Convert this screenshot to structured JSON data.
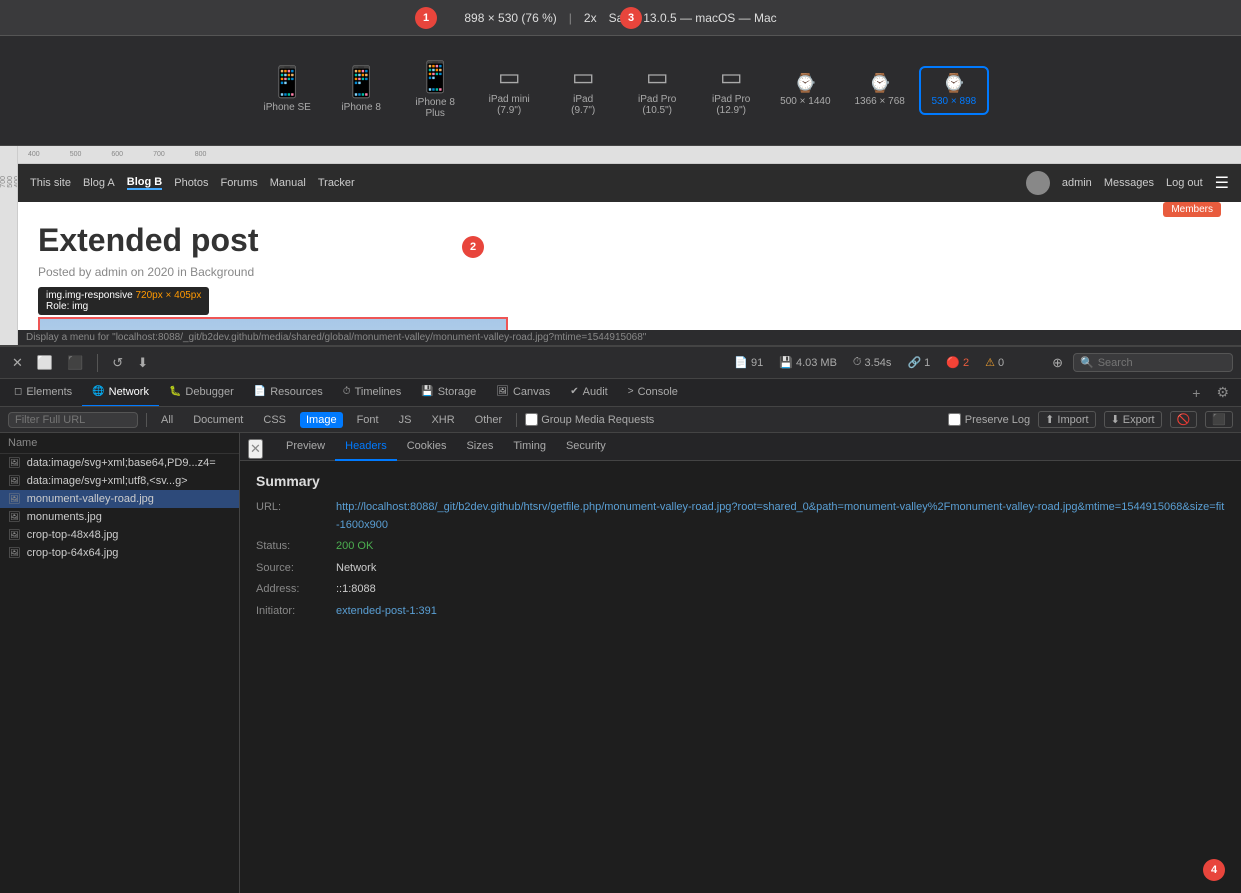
{
  "topbar": {
    "dimensions": "898 × 530  (76 %)",
    "separator": "|",
    "scale": "2x",
    "browser": "Safari 13.0.5 — macOS — Mac",
    "badge1": "1",
    "badge2": "2",
    "badge3": "3",
    "badge4": "4"
  },
  "devices": [
    {
      "id": "iphone-se",
      "label": "iPhone SE",
      "icon": "📱",
      "active": false
    },
    {
      "id": "iphone-8",
      "label": "iPhone 8",
      "icon": "📱",
      "active": false
    },
    {
      "id": "iphone-8-plus",
      "label": "iPhone 8\nPlus",
      "icon": "📱",
      "active": false
    },
    {
      "id": "ipad-mini",
      "label": "iPad mini\n(7.9\")",
      "icon": "📱",
      "active": false
    },
    {
      "id": "ipad-97",
      "label": "iPad\n(9.7\")",
      "icon": "⬜",
      "active": false
    },
    {
      "id": "ipad-pro-105",
      "label": "iPad Pro\n(10.5\")",
      "icon": "⬜",
      "active": false
    },
    {
      "id": "ipad-pro-129",
      "label": "iPad Pro\n(12.9\")",
      "icon": "⬜",
      "active": false
    },
    {
      "id": "500x1440",
      "label": "500 × 1440",
      "icon": "⌚",
      "active": false
    },
    {
      "id": "1366x768",
      "label": "1366 × 768",
      "icon": "⌚",
      "active": false
    },
    {
      "id": "530x898",
      "label": "530 × 898",
      "icon": "⌚",
      "active": true
    }
  ],
  "preview": {
    "nav_items": [
      "This site",
      "Blog A",
      "Blog B",
      "Photos",
      "Forums",
      "Manual",
      "Tracker"
    ],
    "active_nav": "Blog B",
    "admin_links": [
      "admin",
      "Messages",
      "Log out"
    ],
    "post_title": "Extended post",
    "post_meta": "Posted by admin on 2020 in Background",
    "members_badge": "Members",
    "image_tooltip": "img.img-responsive 720px × 405px\nRole: img",
    "status_bar": "Display a menu for \"localhost:8088/_git/b2dev.github/media/shared/global/monument-valley/monument-valley-road.jpg?mtime=1544915068\""
  },
  "devtools_toolbar": {
    "stats": {
      "files": "91",
      "files_icon": "📄",
      "size": "4.03 MB",
      "size_icon": "💾",
      "time": "3.54s",
      "time_icon": "⏱",
      "requests": "1",
      "errors": "2",
      "warnings": "0"
    },
    "search_placeholder": "Search"
  },
  "tabs": [
    {
      "id": "elements",
      "label": "Elements",
      "icon": "◻"
    },
    {
      "id": "network",
      "label": "Network",
      "icon": "🌐",
      "active": true
    },
    {
      "id": "debugger",
      "label": "Debugger",
      "icon": "🐛"
    },
    {
      "id": "resources",
      "label": "Resources",
      "icon": "📄"
    },
    {
      "id": "timelines",
      "label": "Timelines",
      "icon": "⏱"
    },
    {
      "id": "storage",
      "label": "Storage",
      "icon": "💾"
    },
    {
      "id": "canvas",
      "label": "Canvas",
      "icon": "🖼"
    },
    {
      "id": "audit",
      "label": "Audit",
      "icon": "✔"
    },
    {
      "id": "console",
      "label": "Console",
      "icon": ">"
    }
  ],
  "filter": {
    "placeholder": "Filter Full URL",
    "types": [
      "All",
      "Document",
      "CSS",
      "Image",
      "Font",
      "JS",
      "XHR",
      "Other"
    ],
    "active_type": "Image",
    "group_media": "Group Media Requests",
    "preserve_log": "Preserve Log",
    "import": "Import",
    "export": "Export"
  },
  "file_list": {
    "header": "Name",
    "files": [
      {
        "name": "data:image/svg+xml;base64,PD9...z4=",
        "selected": false
      },
      {
        "name": "data:image/svg+xml;utf8,<sv...g>",
        "selected": false
      },
      {
        "name": "monument-valley-road.jpg",
        "selected": true
      },
      {
        "name": "monuments.jpg",
        "selected": false
      },
      {
        "name": "crop-top-48x48.jpg",
        "selected": false
      },
      {
        "name": "crop-top-64x64.jpg",
        "selected": false
      }
    ]
  },
  "detail": {
    "close_icon": "✕",
    "response_tabs": [
      "Preview",
      "Headers",
      "Cookies",
      "Sizes",
      "Timing",
      "Security"
    ],
    "active_tab": "Headers",
    "summary": {
      "title": "Summary",
      "url_label": "URL:",
      "url_value": "http://localhost:8088/_git/b2dev.github/htsrv/getfile.php/monument-valley-road.jpg?root=shared_0&path=monument-valley%2Fmonument-valley-road.jpg&mtime=1544915068&size=fit-1600x900",
      "status_label": "Status:",
      "status_value": "200 OK",
      "source_label": "Source:",
      "source_value": "Network",
      "address_label": "Address:",
      "address_value": "::1:8088",
      "initiator_label": "Initiator:",
      "initiator_value": "extended-post-1:391"
    }
  }
}
